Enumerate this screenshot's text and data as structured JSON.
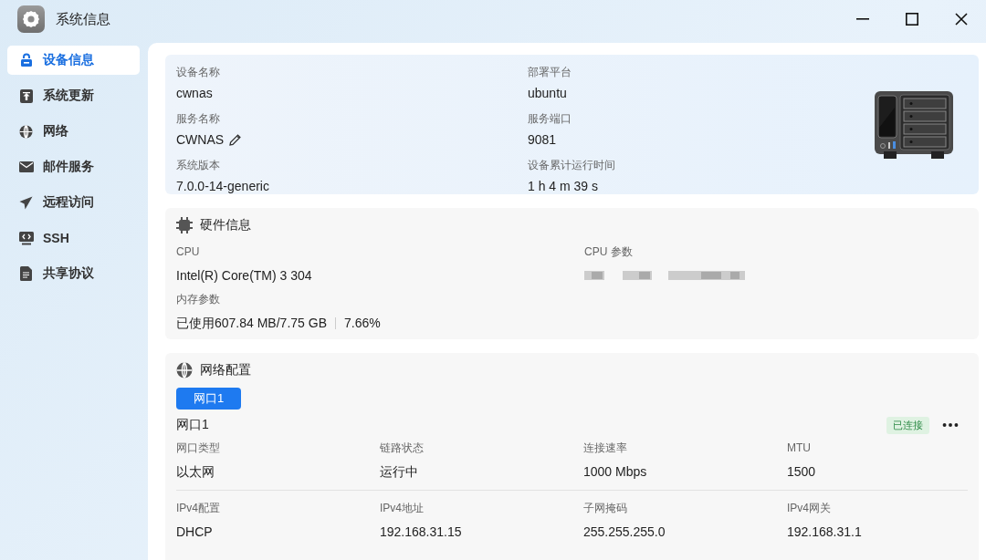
{
  "window": {
    "title": "系统信息"
  },
  "sidebar": {
    "items": [
      {
        "label": "设备信息",
        "selected": true
      },
      {
        "label": "系统更新",
        "selected": false
      },
      {
        "label": "网络",
        "selected": false
      },
      {
        "label": "邮件服务",
        "selected": false
      },
      {
        "label": "远程访问",
        "selected": false
      },
      {
        "label": "SSH",
        "selected": false
      },
      {
        "label": "共享协议",
        "selected": false
      }
    ]
  },
  "device": {
    "fields": [
      {
        "label": "设备名称",
        "value": "cwnas",
        "editable": false
      },
      {
        "label": "部署平台",
        "value": "ubuntu",
        "editable": false
      },
      {
        "label": "服务名称",
        "value": "CWNAS",
        "editable": true
      },
      {
        "label": "服务端口",
        "value": "9081",
        "editable": false
      },
      {
        "label": "系统版本",
        "value": "7.0.0-14-generic",
        "editable": false
      },
      {
        "label": "设备累计运行时间",
        "value": "1 h 4 m 39 s",
        "editable": false
      }
    ]
  },
  "hardware": {
    "title": "硬件信息",
    "fields": [
      {
        "label": "CPU",
        "kind": "text",
        "value": "Intel(R) Core(TM) 3 304"
      },
      {
        "label": "CPU 参数",
        "kind": "redacted"
      },
      {
        "label": "内存参数",
        "kind": "usage",
        "value": "已使用607.84 MB/7.75 GB",
        "percent": "7.66%"
      }
    ]
  },
  "network": {
    "title": "网络配置",
    "tabs": [
      {
        "label": "网口1",
        "selected": true
      }
    ],
    "port": {
      "name": "网口1",
      "status": "已连接",
      "fields": [
        {
          "label": "网口类型",
          "value": "以太网"
        },
        {
          "label": "链路状态",
          "value": "运行中"
        },
        {
          "label": "连接速率",
          "value": "1000 Mbps"
        },
        {
          "label": "MTU",
          "value": "1500"
        },
        {
          "label": "IPv4配置",
          "value": "DHCP"
        },
        {
          "label": "IPv4地址",
          "value": "192.168.31.15"
        },
        {
          "label": "子网掩码",
          "value": "255.255.255.0"
        },
        {
          "label": "IPv4网关",
          "value": "192.168.31.1"
        }
      ]
    }
  }
}
